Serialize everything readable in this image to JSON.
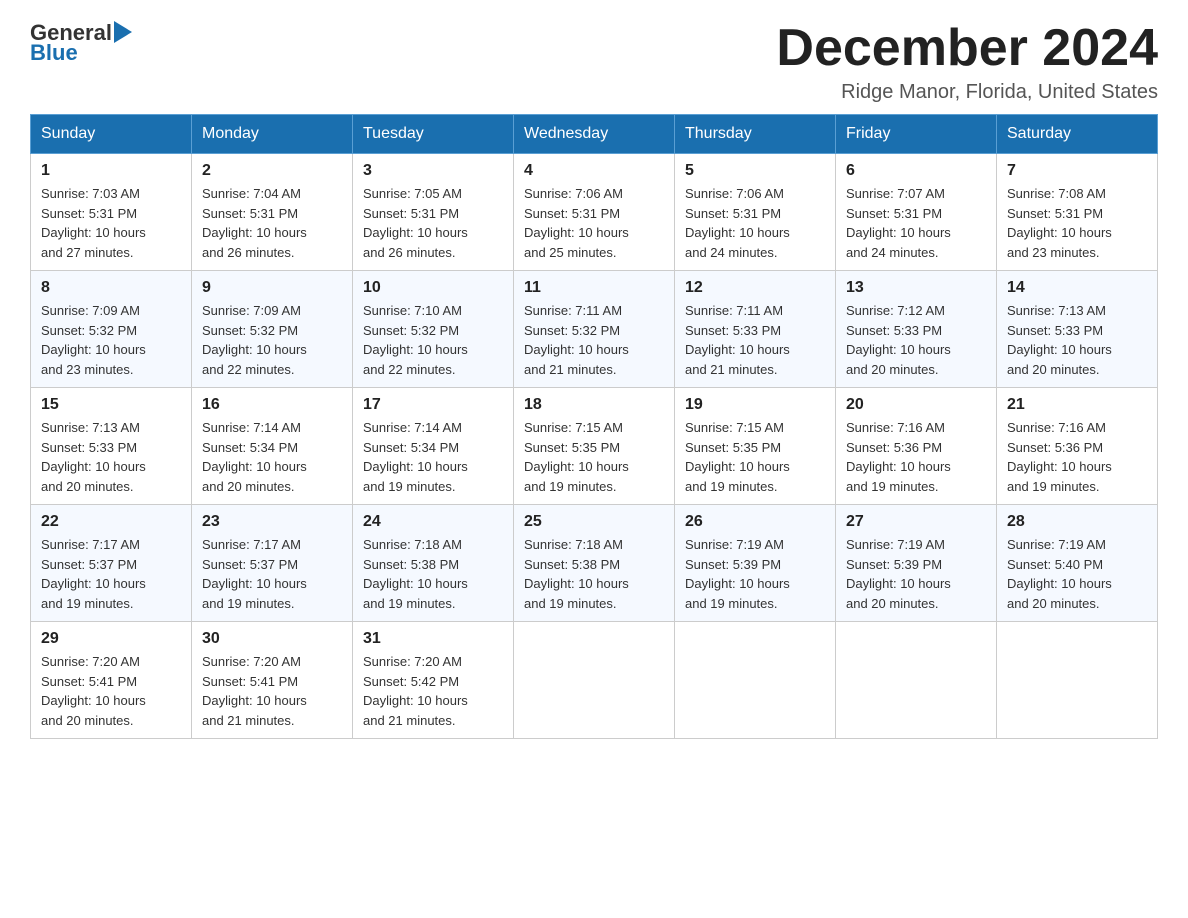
{
  "header": {
    "logo_general": "General",
    "logo_blue": "Blue",
    "month_title": "December 2024",
    "location": "Ridge Manor, Florida, United States"
  },
  "days_of_week": [
    "Sunday",
    "Monday",
    "Tuesday",
    "Wednesday",
    "Thursday",
    "Friday",
    "Saturday"
  ],
  "weeks": [
    [
      {
        "day": "1",
        "sunrise": "7:03 AM",
        "sunset": "5:31 PM",
        "daylight": "10 hours and 27 minutes."
      },
      {
        "day": "2",
        "sunrise": "7:04 AM",
        "sunset": "5:31 PM",
        "daylight": "10 hours and 26 minutes."
      },
      {
        "day": "3",
        "sunrise": "7:05 AM",
        "sunset": "5:31 PM",
        "daylight": "10 hours and 26 minutes."
      },
      {
        "day": "4",
        "sunrise": "7:06 AM",
        "sunset": "5:31 PM",
        "daylight": "10 hours and 25 minutes."
      },
      {
        "day": "5",
        "sunrise": "7:06 AM",
        "sunset": "5:31 PM",
        "daylight": "10 hours and 24 minutes."
      },
      {
        "day": "6",
        "sunrise": "7:07 AM",
        "sunset": "5:31 PM",
        "daylight": "10 hours and 24 minutes."
      },
      {
        "day": "7",
        "sunrise": "7:08 AM",
        "sunset": "5:31 PM",
        "daylight": "10 hours and 23 minutes."
      }
    ],
    [
      {
        "day": "8",
        "sunrise": "7:09 AM",
        "sunset": "5:32 PM",
        "daylight": "10 hours and 23 minutes."
      },
      {
        "day": "9",
        "sunrise": "7:09 AM",
        "sunset": "5:32 PM",
        "daylight": "10 hours and 22 minutes."
      },
      {
        "day": "10",
        "sunrise": "7:10 AM",
        "sunset": "5:32 PM",
        "daylight": "10 hours and 22 minutes."
      },
      {
        "day": "11",
        "sunrise": "7:11 AM",
        "sunset": "5:32 PM",
        "daylight": "10 hours and 21 minutes."
      },
      {
        "day": "12",
        "sunrise": "7:11 AM",
        "sunset": "5:33 PM",
        "daylight": "10 hours and 21 minutes."
      },
      {
        "day": "13",
        "sunrise": "7:12 AM",
        "sunset": "5:33 PM",
        "daylight": "10 hours and 20 minutes."
      },
      {
        "day": "14",
        "sunrise": "7:13 AM",
        "sunset": "5:33 PM",
        "daylight": "10 hours and 20 minutes."
      }
    ],
    [
      {
        "day": "15",
        "sunrise": "7:13 AM",
        "sunset": "5:33 PM",
        "daylight": "10 hours and 20 minutes."
      },
      {
        "day": "16",
        "sunrise": "7:14 AM",
        "sunset": "5:34 PM",
        "daylight": "10 hours and 20 minutes."
      },
      {
        "day": "17",
        "sunrise": "7:14 AM",
        "sunset": "5:34 PM",
        "daylight": "10 hours and 19 minutes."
      },
      {
        "day": "18",
        "sunrise": "7:15 AM",
        "sunset": "5:35 PM",
        "daylight": "10 hours and 19 minutes."
      },
      {
        "day": "19",
        "sunrise": "7:15 AM",
        "sunset": "5:35 PM",
        "daylight": "10 hours and 19 minutes."
      },
      {
        "day": "20",
        "sunrise": "7:16 AM",
        "sunset": "5:36 PM",
        "daylight": "10 hours and 19 minutes."
      },
      {
        "day": "21",
        "sunrise": "7:16 AM",
        "sunset": "5:36 PM",
        "daylight": "10 hours and 19 minutes."
      }
    ],
    [
      {
        "day": "22",
        "sunrise": "7:17 AM",
        "sunset": "5:37 PM",
        "daylight": "10 hours and 19 minutes."
      },
      {
        "day": "23",
        "sunrise": "7:17 AM",
        "sunset": "5:37 PM",
        "daylight": "10 hours and 19 minutes."
      },
      {
        "day": "24",
        "sunrise": "7:18 AM",
        "sunset": "5:38 PM",
        "daylight": "10 hours and 19 minutes."
      },
      {
        "day": "25",
        "sunrise": "7:18 AM",
        "sunset": "5:38 PM",
        "daylight": "10 hours and 19 minutes."
      },
      {
        "day": "26",
        "sunrise": "7:19 AM",
        "sunset": "5:39 PM",
        "daylight": "10 hours and 19 minutes."
      },
      {
        "day": "27",
        "sunrise": "7:19 AM",
        "sunset": "5:39 PM",
        "daylight": "10 hours and 20 minutes."
      },
      {
        "day": "28",
        "sunrise": "7:19 AM",
        "sunset": "5:40 PM",
        "daylight": "10 hours and 20 minutes."
      }
    ],
    [
      {
        "day": "29",
        "sunrise": "7:20 AM",
        "sunset": "5:41 PM",
        "daylight": "10 hours and 20 minutes."
      },
      {
        "day": "30",
        "sunrise": "7:20 AM",
        "sunset": "5:41 PM",
        "daylight": "10 hours and 21 minutes."
      },
      {
        "day": "31",
        "sunrise": "7:20 AM",
        "sunset": "5:42 PM",
        "daylight": "10 hours and 21 minutes."
      },
      null,
      null,
      null,
      null
    ]
  ],
  "labels": {
    "sunrise": "Sunrise:",
    "sunset": "Sunset:",
    "daylight": "Daylight:"
  }
}
